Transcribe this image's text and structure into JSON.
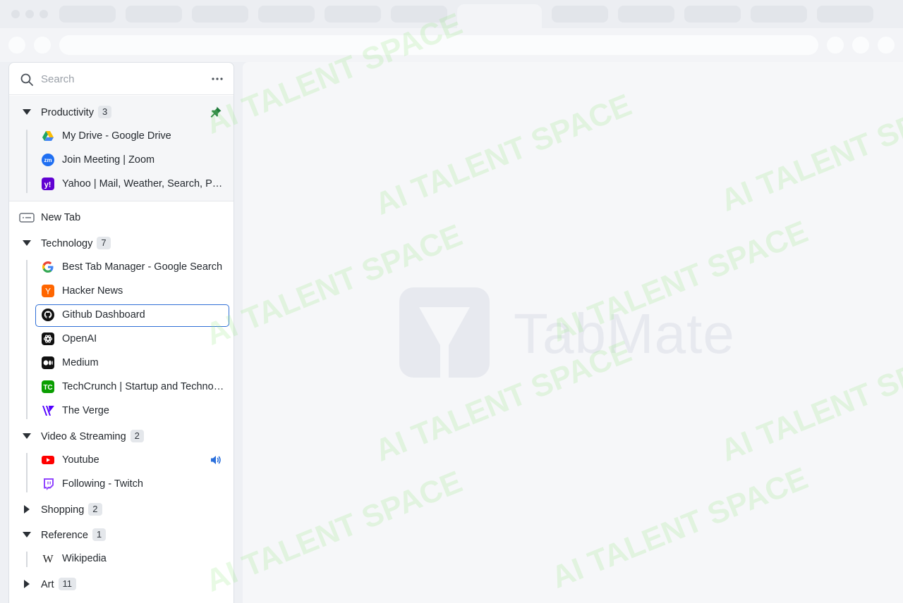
{
  "search": {
    "placeholder": "Search"
  },
  "pinned_group": {
    "title": "Productivity",
    "count": "3",
    "tabs": [
      {
        "title": "My Drive - Google Drive",
        "icon": "google-drive-icon"
      },
      {
        "title": "Join Meeting | Zoom",
        "icon": "zoom-icon"
      },
      {
        "title": "Yahoo | Mail, Weather, Search, Politics, News, Finance, Sports & Videos",
        "icon": "yahoo-icon"
      }
    ]
  },
  "new_tab": {
    "label": "New Tab"
  },
  "groups": [
    {
      "title": "Technology",
      "count": "7",
      "expanded": true,
      "tabs": [
        {
          "title": "Best Tab Manager - Google Search",
          "icon": "google-icon"
        },
        {
          "title": "Hacker News",
          "icon": "hacker-news-icon"
        },
        {
          "title": "Github Dashboard",
          "icon": "github-icon",
          "selected": true
        },
        {
          "title": "OpenAI",
          "icon": "openai-icon"
        },
        {
          "title": "Medium",
          "icon": "medium-icon"
        },
        {
          "title": "TechCrunch | Startup and Technology News",
          "icon": "techcrunch-icon"
        },
        {
          "title": "The Verge",
          "icon": "the-verge-icon"
        }
      ]
    },
    {
      "title": "Video & Streaming",
      "count": "2",
      "expanded": true,
      "tabs": [
        {
          "title": "Youtube",
          "icon": "youtube-icon",
          "audible": true
        },
        {
          "title": "Following - Twitch",
          "icon": "twitch-icon"
        }
      ]
    },
    {
      "title": "Shopping",
      "count": "2",
      "expanded": false
    },
    {
      "title": "Reference",
      "count": "1",
      "expanded": true,
      "tabs": [
        {
          "title": "Wikipedia",
          "icon": "wikipedia-icon"
        }
      ]
    },
    {
      "title": "Art",
      "count": "11",
      "expanded": false
    }
  ],
  "brand": {
    "name": "TabMate"
  },
  "watermark": "AI TALENT SPACE",
  "colors": {
    "selected_border": "#2f6fd6",
    "pin": "#1f7a3a",
    "audio": "#2a6fdb"
  }
}
